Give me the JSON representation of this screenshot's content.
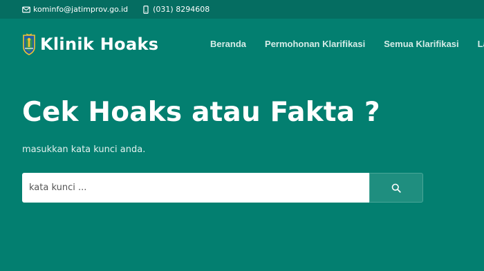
{
  "topbar": {
    "email": "kominfo@jatimprov.go.id",
    "phone": "(031) 8294608",
    "email_icon": "envelope-icon",
    "phone_icon": "mobile-phone-icon"
  },
  "brand": {
    "logo": "jatim-coat-of-arms-logo",
    "title": "Klinik Hoaks"
  },
  "nav": {
    "items": [
      {
        "label": "Beranda"
      },
      {
        "label": "Permohonan Klarifikasi"
      },
      {
        "label": "Semua Klarifikasi"
      },
      {
        "label": "Lac"
      }
    ]
  },
  "hero": {
    "title": "Cek Hoaks atau Fakta ?",
    "subtitle": "masukkan kata kunci anda."
  },
  "search": {
    "placeholder": "kata kunci ...",
    "value": "",
    "button_icon": "search-icon"
  },
  "colors": {
    "background": "#037f70",
    "topbar": "#056d61",
    "search_button": "#1f8e7f"
  }
}
